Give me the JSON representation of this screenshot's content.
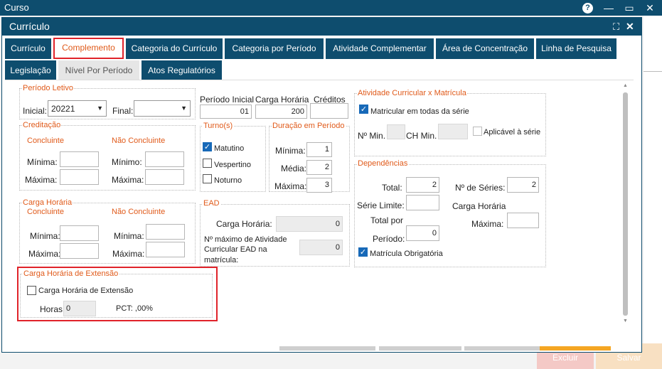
{
  "app": {
    "title": "Curso",
    "help": "?",
    "minimize": "—",
    "maximize": "▭",
    "close": "✕"
  },
  "window": {
    "title": "Currículo",
    "expand": "⛶",
    "close": "✕"
  },
  "tabs_row1": [
    {
      "label": "Currículo"
    },
    {
      "label": "Complemento"
    },
    {
      "label": "Categoria do Currículo"
    },
    {
      "label": "Categoria por Período"
    },
    {
      "label": "Atividade Complementar"
    },
    {
      "label": "Área de Concentração"
    },
    {
      "label": "Linha de Pesquisa"
    }
  ],
  "tabs_row2": [
    {
      "label": "Legislação"
    },
    {
      "label": "Nível Por Período"
    },
    {
      "label": "Atos Regulatórios"
    }
  ],
  "periodo_letivo": {
    "legend": "Período Letivo",
    "inicial_label": "Inicial:",
    "inicial_value": "20221",
    "final_label": "Final:",
    "final_value": ""
  },
  "top_fields": {
    "periodo_inicial_label": "Período Inicial",
    "periodo_inicial_value": "01",
    "carga_horaria_label": "Carga Horária",
    "carga_horaria_value": "200",
    "creditos_label": "Créditos",
    "creditos_value": ""
  },
  "atividade": {
    "legend": "Atividade Curricular x Matrícula",
    "matricular_label": "Matricular em todas da série",
    "nmin_label": "Nº Min.",
    "chmin_label": "CH Min.",
    "aplicavel_label": "Aplicável à série"
  },
  "creditacao": {
    "legend": "Creditação",
    "concluinte": "Concluinte",
    "nao_concluinte": "Não Concluinte",
    "minima": "Mínima:",
    "maxima": "Máxima:",
    "minimo": "Mínimo:"
  },
  "turnos": {
    "legend": "Turno(s)",
    "matutino": "Matutino",
    "vespertino": "Vespertino",
    "noturno": "Noturno"
  },
  "duracao": {
    "legend": "Duração em Período",
    "minima": "Mínima:",
    "media": "Média:",
    "maxima": "Máxima:",
    "minima_value": "1",
    "media_value": "2",
    "maxima_value": "3"
  },
  "dependencias": {
    "legend": "Dependências",
    "total_label": "Total:",
    "total_value": "2",
    "nseries_label": "Nº de Séries:",
    "nseries_value": "2",
    "serie_limite_label": "Série Limite:",
    "total_periodo_label1": "Total por",
    "total_periodo_label2": "Período:",
    "total_periodo_value": "0",
    "carga_horaria_label": "Carga Horária",
    "maxima_label": "Máxima:",
    "obrigatoria_label": "Matrícula Obrigatória"
  },
  "carga_horaria": {
    "legend": "Carga Horária",
    "concluinte": "Concluinte",
    "nao_concluinte": "Não Concluinte",
    "minima": "Mínima:",
    "maxima": "Máxima:"
  },
  "ead": {
    "legend": "EAD",
    "carga_label": "Carga Horária:",
    "carga_value": "0",
    "max_label1": "Nº máximo de Atividade",
    "max_label2": "Curricular EAD na",
    "max_label3": "matrícula:",
    "max_value": "0"
  },
  "extensao": {
    "legend": "Carga Horária de Extensão",
    "checkbox_label": "Carga Horária de Extensão",
    "horas_label": "Horas:",
    "horas_value": "0",
    "pct_label": "PCT: ,00%"
  },
  "footer": {
    "excluir": "Excluir",
    "salvar": "Salvar"
  },
  "colors": {
    "brand": "#0e4d6e",
    "accent": "#e05a1a",
    "highlight": "#e0232a",
    "checkbox": "#1769b8"
  }
}
